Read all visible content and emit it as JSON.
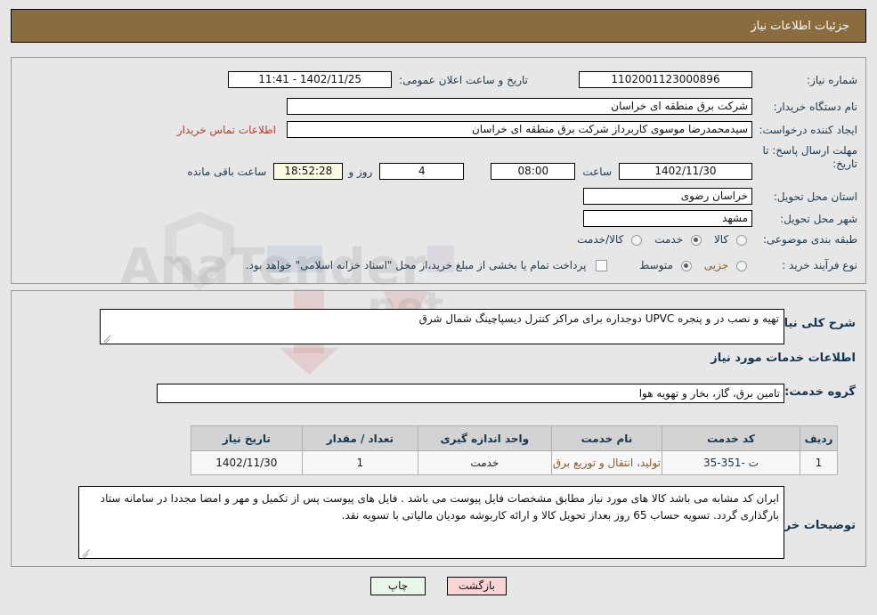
{
  "header": {
    "title": "جزئیات اطلاعات نیاز"
  },
  "watermark": {
    "text": "AnaTender",
    "text2": ".net"
  },
  "top_panel": {
    "need_number": {
      "label": "شماره نیاز:",
      "value": "1102001123000896"
    },
    "announce_datetime": {
      "label": "تاریخ و ساعت اعلان عمومی:",
      "value": "1402/11/25 - 11:41"
    },
    "buyer_org": {
      "label": "نام دستگاه خریدار:",
      "value": "شرکت برق منطقه ای خراسان"
    },
    "requester": {
      "label": "ایجاد کننده درخواست:",
      "value": "سیدمحمدرضا موسوی کاربرداز شرکت برق منطقه ای خراسان"
    },
    "contact_link": "اطلاعات تماس خریدار",
    "deadline": {
      "label": "مهلت ارسال پاسخ: تا تاریخ:",
      "date": "1402/11/30",
      "hour_label": "ساعت",
      "hour": "08:00",
      "days": "4",
      "days_label": "روز و",
      "remaining": "18:52:28",
      "remaining_label": "ساعت باقی مانده"
    },
    "province": {
      "label": "استان محل تحویل:",
      "value": "خراسان رضوی"
    },
    "city": {
      "label": "شهر محل تحویل:",
      "value": "مشهد"
    },
    "category": {
      "label": "طبقه بندی موضوعی:",
      "options": [
        "کالا",
        "خدمت",
        "کالا/خدمت"
      ],
      "selected": "خدمت"
    },
    "process_type": {
      "label": "نوع فرآیند خرید :",
      "options": [
        "جزیی",
        "متوسط"
      ],
      "selected": "متوسط"
    },
    "treasury_note": {
      "text": "پرداخت تمام یا بخشی از مبلغ خرید،از محل \"اسناد خزانه اسلامی\" خواهد بود.",
      "checked": false
    }
  },
  "main_panel": {
    "need_desc": {
      "label": "شرح کلی نیاز:",
      "value": "تهیه و نصب در و پنجره  UPVC دوجداره برای مراکز کنترل دیسپاچینگ شمال شرق"
    },
    "services_section_title": "اطلاعات خدمات مورد نیاز",
    "service_group": {
      "label": "گروه خدمت:",
      "value": "تامین برق، گاز، بخار و تهویه هوا"
    },
    "table": {
      "headers": [
        "ردیف",
        "کد خدمت",
        "نام خدمت",
        "واحد اندازه گیری",
        "تعداد / مقدار",
        "تاریخ نیاز"
      ],
      "rows": [
        {
          "row": "1",
          "code": "ت -351-35",
          "name": "تولید، انتقال و توزیع برق",
          "unit": "خدمت",
          "qty": "1",
          "date": "1402/11/30"
        }
      ]
    },
    "buyer_notes": {
      "label": "توضیحات خریدار:",
      "value": "ایران کد مشابه می باشد کالا های مورد نیاز مطابق مشخصات فایل پیوست می باشد . فایل های پیوست پس از تکمیل و مهر و امضا مجددا در سامانه ستاد بارگذاری گردد. تسویه حساب 65 روز بعداز تحویل کالا و ارائه کاربوشه مودیان مالیاتی با تسویه نقد."
    }
  },
  "buttons": {
    "print": "چاپ",
    "back": "بازگشت"
  }
}
